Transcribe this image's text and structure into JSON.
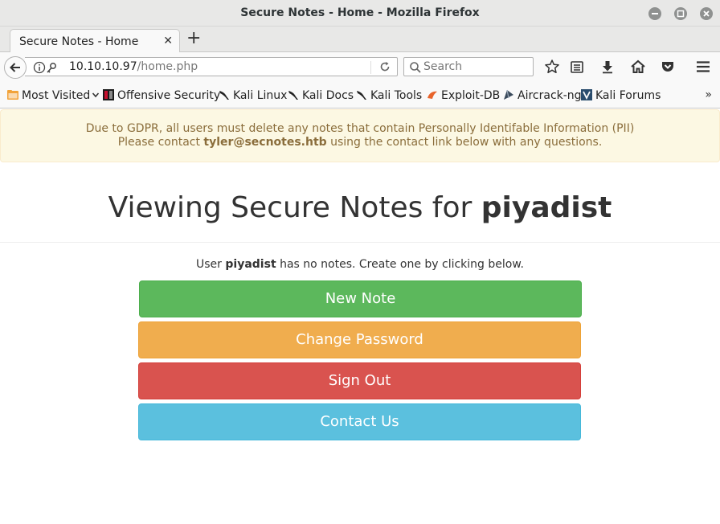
{
  "window": {
    "title": "Secure Notes - Home - Mozilla Firefox"
  },
  "tabs": [
    {
      "label": "Secure Notes - Home"
    }
  ],
  "navbar": {
    "url_host": "10.10.10.97",
    "url_path": "/home.php",
    "search_placeholder": "Search"
  },
  "bookmarks": [
    {
      "label": "Most Visited",
      "icon": "folder-icon"
    },
    {
      "label": "Offensive Security",
      "icon": "offsec-icon"
    },
    {
      "label": "Kali Linux",
      "icon": "kali-dragon-icon"
    },
    {
      "label": "Kali Docs",
      "icon": "kali-dragon-icon"
    },
    {
      "label": "Kali Tools",
      "icon": "kali-dragon-icon"
    },
    {
      "label": "Exploit-DB",
      "icon": "exploitdb-icon"
    },
    {
      "label": "Aircrack-ng",
      "icon": "aircrack-icon"
    },
    {
      "label": "Kali Forums",
      "icon": "kali-forums-icon"
    }
  ],
  "page": {
    "alert_line1": "Due to GDPR, all users must delete any notes that contain Personally Identifable Information (PII)",
    "alert_line2_prefix": "Please contact ",
    "alert_email": "tyler@secnotes.htb",
    "alert_line2_suffix": " using the contact link below with any questions.",
    "heading_prefix": "Viewing Secure Notes for ",
    "username": "piyadist",
    "info_prefix": "User ",
    "info_suffix": " has no notes. Create one by clicking below.",
    "buttons": {
      "new_note": "New Note",
      "change_password": "Change Password",
      "sign_out": "Sign Out",
      "contact_us": "Contact Us"
    }
  },
  "colors": {
    "new_note": "#5cb85c",
    "change_password": "#f0ad4e",
    "sign_out": "#d9534f",
    "contact_us": "#5bc0de",
    "alert_bg": "#fcf8e3",
    "alert_text": "#8a6d3b"
  }
}
